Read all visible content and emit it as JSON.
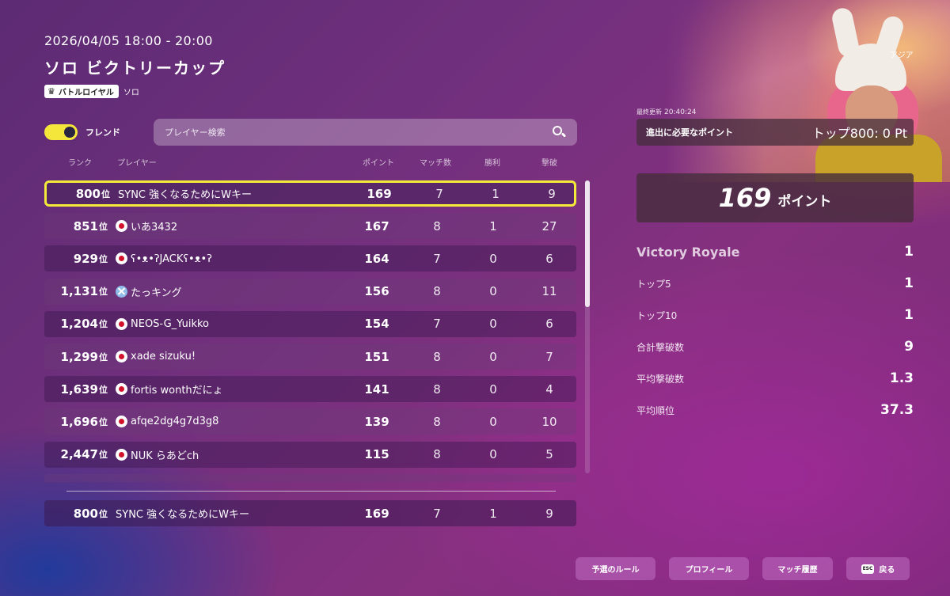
{
  "event": {
    "date": "2026/04/05 18:00 - 20:00",
    "title": "ソロ ビクトリーカップ",
    "mode_badge": "バトルロイヤル",
    "mode_icon": "crown-icon",
    "mode_sub": "ソロ"
  },
  "friends_toggle": {
    "label": "フレンド",
    "on": true
  },
  "search": {
    "placeholder": "プレイヤー検索"
  },
  "columns": {
    "rank": "ランク",
    "player": "プレイヤー",
    "points": "ポイント",
    "matches": "マッチ数",
    "wins": "勝利",
    "kills": "撃破"
  },
  "rows": [
    {
      "rank": "800",
      "suffix": "位",
      "flag": "none",
      "name": "SYNC 強くなるためにWキー",
      "points": "169",
      "matches": "7",
      "wins": "1",
      "kills": "9"
    },
    {
      "rank": "851",
      "suffix": "位",
      "flag": "jp",
      "name": "いあ3432",
      "points": "167",
      "matches": "8",
      "wins": "1",
      "kills": "27"
    },
    {
      "rank": "929",
      "suffix": "位",
      "flag": "jp",
      "name": "ʕ•ᴥ•ʔJACKʕ•ᴥ•ʔ",
      "points": "164",
      "matches": "7",
      "wins": "0",
      "kills": "6"
    },
    {
      "rank": "1,131",
      "suffix": "位",
      "flag": "x",
      "name": "たっキング",
      "points": "156",
      "matches": "8",
      "wins": "0",
      "kills": "11"
    },
    {
      "rank": "1,204",
      "suffix": "位",
      "flag": "jp",
      "name": "NEOS-G_Yuikko",
      "points": "154",
      "matches": "7",
      "wins": "0",
      "kills": "6"
    },
    {
      "rank": "1,299",
      "suffix": "位",
      "flag": "jp",
      "name": "xade sizuku!",
      "points": "151",
      "matches": "8",
      "wins": "0",
      "kills": "7"
    },
    {
      "rank": "1,639",
      "suffix": "位",
      "flag": "jp",
      "name": "fortis wonthだにょ",
      "points": "141",
      "matches": "8",
      "wins": "0",
      "kills": "4"
    },
    {
      "rank": "1,696",
      "suffix": "位",
      "flag": "jp",
      "name": "afqe2dg4g7d3g8",
      "points": "139",
      "matches": "8",
      "wins": "0",
      "kills": "10"
    },
    {
      "rank": "2,447",
      "suffix": "位",
      "flag": "jp",
      "name": "NUK らあどch",
      "points": "115",
      "matches": "8",
      "wins": "0",
      "kills": "5"
    }
  ],
  "pinned_row": {
    "rank": "800",
    "suffix": "位",
    "name": "SYNC 強くなるためにWキー",
    "points": "169",
    "matches": "7",
    "wins": "1",
    "kills": "9"
  },
  "scroll_position": 0.0,
  "region": "アジア",
  "last_updated": {
    "label": "最終更新",
    "time": "20:40:24"
  },
  "required_points": {
    "label": "進出に必要なポイント",
    "value": "トップ800: 0 Pt"
  },
  "total_points": {
    "value": "169",
    "unit": "ポイント"
  },
  "stats": [
    {
      "label": "Victory Royale",
      "value": "1"
    },
    {
      "label": "トップ5",
      "value": "1"
    },
    {
      "label": "トップ10",
      "value": "1"
    },
    {
      "label": "合計撃破数",
      "value": "9"
    },
    {
      "label": "平均撃破数",
      "value": "1.3"
    },
    {
      "label": "平均順位",
      "value": "37.3"
    }
  ],
  "footer": {
    "rules": "予選のルール",
    "profile": "プロフィール",
    "history": "マッチ履歴",
    "back_key": "ESC",
    "back": "戻る"
  },
  "colors": {
    "highlight": "#f3ea3a",
    "toggle_on": "#f4e63a",
    "flag_red": "#d3132b"
  }
}
